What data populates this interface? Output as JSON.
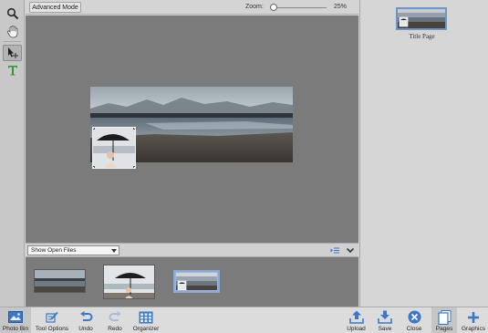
{
  "toolbar": {
    "mode_button": "Advanced Mode",
    "zoom_label": "Zoom:",
    "zoom_value": "25%",
    "zoom_fraction": 0.0
  },
  "tools": [
    {
      "name": "zoom-tool",
      "icon": "magnifier-icon"
    },
    {
      "name": "hand-tool",
      "icon": "hand-icon"
    },
    {
      "name": "move-tool",
      "icon": "move-cursor-icon"
    },
    {
      "name": "type-tool",
      "icon": "type-t-icon"
    }
  ],
  "photo_bin": {
    "dropdown_value": "Show Open Files",
    "thumbnails": [
      {
        "label": "beach panorama",
        "selected": false
      },
      {
        "label": "umbrella portrait",
        "selected": false
      },
      {
        "label": "project composite",
        "selected": true
      }
    ]
  },
  "pages_panel": {
    "page_label": "Title Page"
  },
  "taskbar": {
    "left": [
      {
        "label": "Photo Bin",
        "icon": "photo-bin-icon",
        "active": true
      },
      {
        "label": "Tool Options",
        "icon": "tool-options-icon",
        "active": false
      },
      {
        "label": "Undo",
        "icon": "undo-icon",
        "active": false
      },
      {
        "label": "Redo",
        "icon": "redo-icon",
        "active": false
      },
      {
        "label": "Organizer",
        "icon": "organizer-icon",
        "active": false
      }
    ],
    "right": [
      {
        "label": "Upload",
        "icon": "upload-icon",
        "active": false
      },
      {
        "label": "Save",
        "icon": "save-icon",
        "active": false
      },
      {
        "label": "Close",
        "icon": "close-icon",
        "active": false
      },
      {
        "label": "Pages",
        "icon": "pages-icon",
        "active": true
      },
      {
        "label": "Graphics",
        "icon": "graphics-plus-icon",
        "active": false
      }
    ]
  },
  "colors": {
    "accent": "#3d78c6",
    "canvas_bg": "#7b7b7b",
    "panel_bg": "#d6d6d6"
  }
}
